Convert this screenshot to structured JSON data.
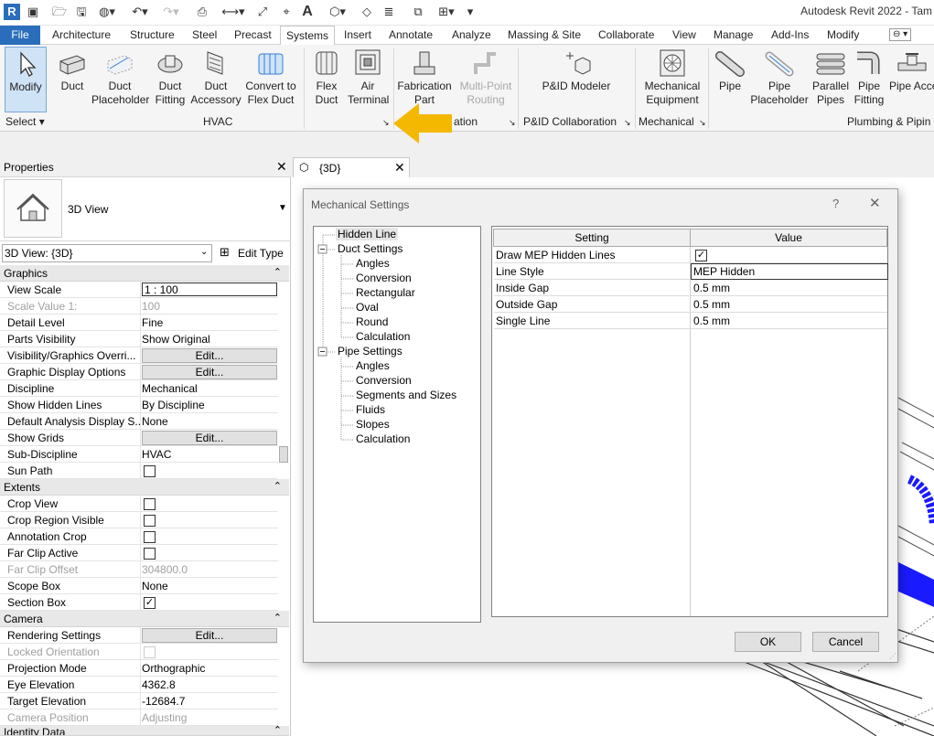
{
  "window": {
    "title": "Autodesk Revit 2022 - Tam"
  },
  "tabs": {
    "file": "File",
    "items": [
      "Architecture",
      "Structure",
      "Steel",
      "Precast",
      "Systems",
      "Insert",
      "Annotate",
      "Analyze",
      "Massing & Site",
      "Collaborate",
      "View",
      "Manage",
      "Add-Ins",
      "Modify"
    ],
    "active": "Systems"
  },
  "ribbon": {
    "buttons": {
      "modify": "Modify",
      "duct": "Duct",
      "duct_placeholder": "Duct Placeholder",
      "duct_fitting": "Duct Fitting",
      "duct_accessory": "Duct Accessory",
      "convert_flex": "Convert to Flex Duct",
      "flex_duct": "Flex Duct",
      "air_terminal": "Air Terminal",
      "fabrication_part": "Fabrication Part",
      "multipoint_routing": "Multi-Point Routing",
      "pid_modeler": "P&ID Modeler",
      "mech_equipment": "Mechanical Equipment",
      "pipe": "Pipe",
      "pipe_placeholder": "Pipe Placeholder",
      "parallel_pipes": "Parallel Pipes",
      "pipe_fitting": "Pipe Fitting",
      "pipe_accessory": "Pipe Accessor"
    },
    "panels": {
      "select": "Select",
      "hvac": "HVAC",
      "fabrication": "ation",
      "pid": "P&ID Collaboration",
      "mechanical": "Mechanical",
      "plumbing": "Plumbing & Pipin"
    }
  },
  "properties": {
    "title": "Properties",
    "type_name": "3D View",
    "instance_selector": "3D View: {3D}",
    "edit_type": "Edit Type",
    "groups": {
      "graphics": "Graphics",
      "extents": "Extents",
      "camera": "Camera",
      "identity": "Identity Data"
    },
    "rows": {
      "view_scale": {
        "k": "View Scale",
        "v": "1 : 100"
      },
      "scale_value": {
        "k": "Scale Value    1:",
        "v": "100"
      },
      "detail_level": {
        "k": "Detail Level",
        "v": "Fine"
      },
      "parts_visibility": {
        "k": "Parts Visibility",
        "v": "Show Original"
      },
      "vis_graphics": {
        "k": "Visibility/Graphics Overri...",
        "v": "Edit..."
      },
      "graphic_display": {
        "k": "Graphic Display Options",
        "v": "Edit..."
      },
      "discipline": {
        "k": "Discipline",
        "v": "Mechanical"
      },
      "hidden_lines": {
        "k": "Show Hidden Lines",
        "v": "By Discipline"
      },
      "analysis_display": {
        "k": "Default Analysis Display S...",
        "v": "None"
      },
      "show_grids": {
        "k": "Show Grids",
        "v": "Edit..."
      },
      "sub_discipline": {
        "k": "Sub-Discipline",
        "v": "HVAC"
      },
      "sun_path": {
        "k": "Sun Path"
      },
      "crop_view": {
        "k": "Crop View"
      },
      "crop_region": {
        "k": "Crop Region Visible"
      },
      "annotation_crop": {
        "k": "Annotation Crop"
      },
      "far_clip_active": {
        "k": "Far Clip Active"
      },
      "far_clip_offset": {
        "k": "Far Clip Offset",
        "v": "304800.0"
      },
      "scope_box": {
        "k": "Scope Box",
        "v": "None"
      },
      "section_box": {
        "k": "Section Box"
      },
      "rendering": {
        "k": "Rendering Settings",
        "v": "Edit..."
      },
      "locked_orientation": {
        "k": "Locked Orientation"
      },
      "projection": {
        "k": "Projection Mode",
        "v": "Orthographic"
      },
      "eye_elevation": {
        "k": "Eye Elevation",
        "v": "4362.8"
      },
      "target_elevation": {
        "k": "Target Elevation",
        "v": "-12684.7"
      },
      "camera_position": {
        "k": "Camera Position",
        "v": "Adjusting"
      }
    }
  },
  "document": {
    "tab": "{3D}"
  },
  "dialog": {
    "title": "Mechanical Settings",
    "help": "?",
    "tree": {
      "hidden_line": "Hidden Line",
      "duct_settings": "Duct Settings",
      "duct_children": [
        "Angles",
        "Conversion",
        "Rectangular",
        "Oval",
        "Round",
        "Calculation"
      ],
      "pipe_settings": "Pipe Settings",
      "pipe_children": [
        "Angles",
        "Conversion",
        "Segments and Sizes",
        "Fluids",
        "Slopes",
        "Calculation"
      ]
    },
    "grid": {
      "col_setting": "Setting",
      "col_value": "Value",
      "rows": [
        {
          "s": "Draw MEP Hidden Lines",
          "v": ""
        },
        {
          "s": "Line Style",
          "v": "MEP Hidden"
        },
        {
          "s": "Inside Gap",
          "v": "0.5 mm"
        },
        {
          "s": "Outside Gap",
          "v": "0.5 mm"
        },
        {
          "s": "Single Line",
          "v": "0.5 mm"
        }
      ]
    },
    "ok": "OK",
    "cancel": "Cancel"
  },
  "colors": {
    "file_tab": "#2a6ebb",
    "arrow": "#f5b800",
    "model_blue": "#1a1aff"
  }
}
